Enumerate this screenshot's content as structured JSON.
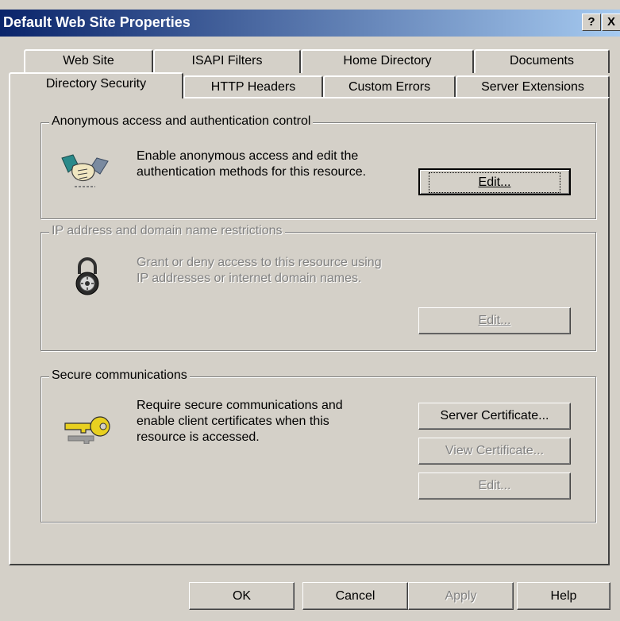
{
  "window": {
    "title": "Default Web Site Properties",
    "help_button": "?",
    "close_button": "X"
  },
  "tabs_row1": [
    "Web Site",
    "ISAPI Filters",
    "Home Directory",
    "Documents"
  ],
  "tabs_row2": [
    "Directory Security",
    "HTTP Headers",
    "Custom Errors",
    "Server Extensions"
  ],
  "active_tab": "Directory Security",
  "anonymous": {
    "legend": "Anonymous access and authentication control",
    "line1": "Enable anonymous access and edit the",
    "line2": "authentication methods for this resource.",
    "edit_button": "Edit...",
    "icon": "handshake-icon"
  },
  "ip": {
    "legend": "IP address and domain name restrictions",
    "line1": "Grant or deny access to this resource using",
    "line2": "IP addresses or internet domain names.",
    "edit_button": "Edit...",
    "icon": "padlock-icon"
  },
  "secure": {
    "legend": "Secure communications",
    "line1": "Require secure communications and",
    "line2": "enable client certificates when this",
    "line3": "resource is accessed.",
    "server_cert_button": "Server Certificate...",
    "view_cert_button": "View Certificate...",
    "edit_button": "Edit...",
    "icon": "key-icon"
  },
  "footer": {
    "ok": "OK",
    "cancel": "Cancel",
    "apply": "Apply",
    "help": "Help"
  },
  "colors": {
    "face": "#d4d0c8",
    "title_start": "#0a246a",
    "title_end": "#a6caf0",
    "disabled_text": "#808080"
  }
}
